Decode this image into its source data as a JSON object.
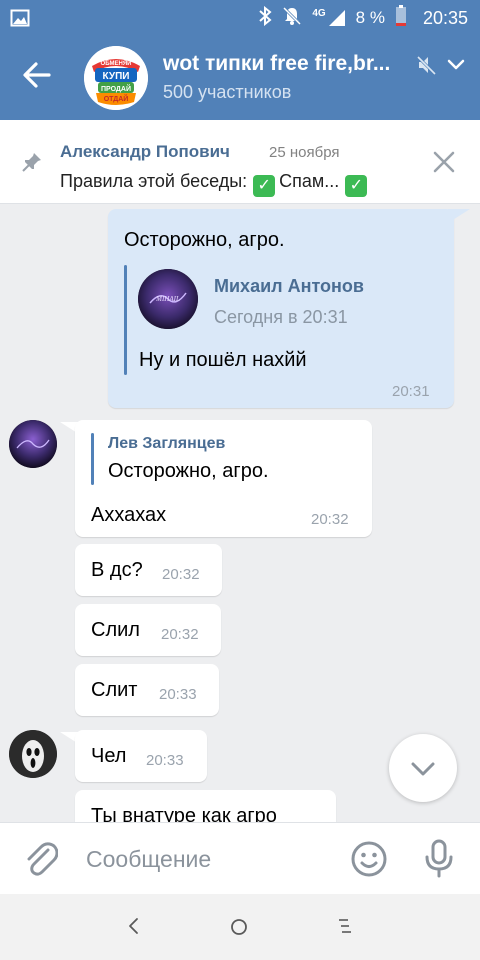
{
  "status_bar": {
    "network": "4G",
    "battery": "8 %",
    "time": "20:35"
  },
  "header": {
    "title": "wot типки free fire,br...",
    "subtitle": "500 участников",
    "avatar_text": [
      "ОБМЕНЯЙ",
      "КУПИ",
      "ПРОДАЙ",
      "ОТДАЙ"
    ]
  },
  "pinned": {
    "author": "Александр Попович",
    "date": "25 ноября",
    "text": "Правила этой беседы:",
    "text_tail": "Спам..."
  },
  "messages": {
    "m1": {
      "text": "Осторожно, агро.",
      "forward_author": "Михаил Антонов",
      "forward_time": "Сегодня в 20:31",
      "forward_text": "Ну и пошёл нахйй",
      "time": "20:31"
    },
    "m2": {
      "reply_author": "Лев Заглянцев",
      "reply_text": "Осторожно, агро.",
      "text": "Аххахах",
      "time": "20:32"
    },
    "m3": {
      "text": "В дс?",
      "time": "20:32"
    },
    "m4": {
      "text": "Слил",
      "time": "20:32"
    },
    "m5": {
      "text": "Слит",
      "time": "20:33"
    },
    "m6": {
      "text": "Чел",
      "time": "20:33"
    },
    "m7": {
      "text": "Ты внатуре как агро"
    }
  },
  "input": {
    "placeholder": "Сообщение"
  },
  "icons": {
    "status": [
      "image-icon",
      "bluetooth-icon",
      "mute-bell-icon",
      "signal-icon",
      "battery-icon"
    ],
    "header": [
      "back-arrow-icon",
      "muted-icon",
      "chevron-down-icon"
    ],
    "pinned": [
      "pin-icon",
      "close-icon"
    ],
    "input": [
      "attach-icon",
      "emoji-icon",
      "microphone-icon"
    ],
    "nav": [
      "nav-back-icon",
      "nav-home-icon",
      "nav-recents-icon"
    ]
  },
  "colors": {
    "header": "#5181b8",
    "outgoing_bubble": "#dae8f8",
    "link_name": "#4a6d93",
    "background": "#edeef0"
  }
}
